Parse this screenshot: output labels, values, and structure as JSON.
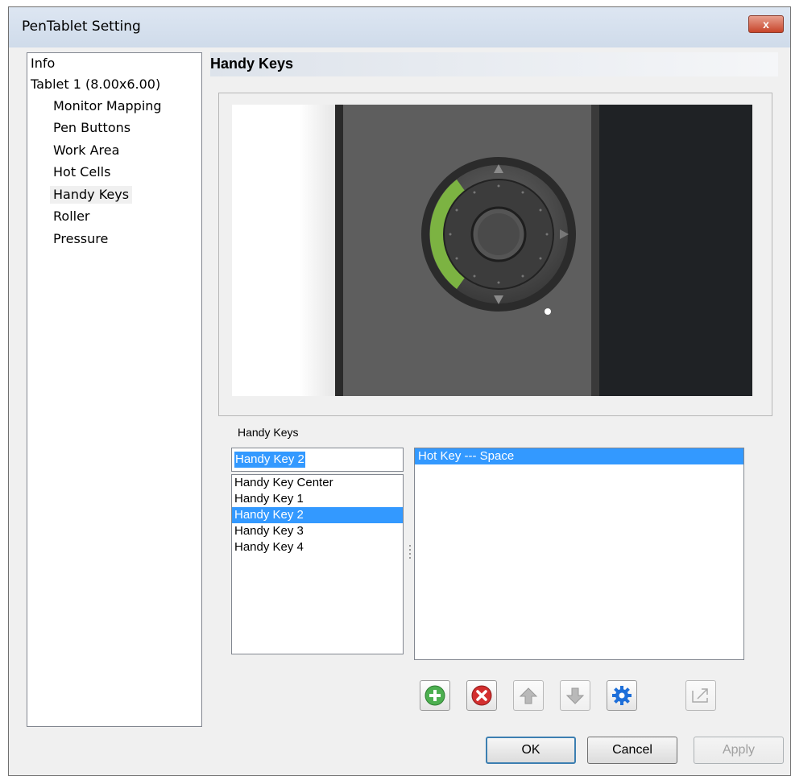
{
  "window": {
    "title": "PenTablet Setting",
    "close_label": "x"
  },
  "tree": [
    {
      "label": "Info",
      "level": 0
    },
    {
      "label": "Tablet 1 (8.00x6.00)",
      "level": 0
    },
    {
      "label": "Monitor Mapping",
      "level": 1
    },
    {
      "label": "Pen Buttons",
      "level": 1
    },
    {
      "label": "Work Area",
      "level": 1
    },
    {
      "label": "Hot Cells",
      "level": 1
    },
    {
      "label": "Handy Keys",
      "level": 1,
      "selected": true
    },
    {
      "label": "Roller",
      "level": 1
    },
    {
      "label": "Pressure",
      "level": 1
    }
  ],
  "panel": {
    "header": "Handy Keys"
  },
  "handy_keys": {
    "group_label": "Handy Keys",
    "current_value": "Handy Key 2",
    "items": [
      "Handy Key Center",
      "Handy Key 1",
      "Handy Key 2",
      "Handy Key 3",
      "Handy Key 4"
    ],
    "selected_item": "Handy Key 2"
  },
  "hotkey_list": {
    "items": [
      "Hot Key --- Space"
    ],
    "selected_item": "Hot Key --- Space"
  },
  "toolbar": {
    "add_icon": "plus-circle-icon",
    "remove_icon": "x-circle-icon",
    "move_up_icon": "arrow-up-icon",
    "move_down_icon": "arrow-down-icon",
    "settings_icon": "gear-icon",
    "import_icon": "import-icon"
  },
  "buttons": {
    "ok": "OK",
    "cancel": "Cancel",
    "apply": "Apply"
  },
  "colors": {
    "selection": "#3399ff",
    "ring_highlight": "#7cb342",
    "close_button": "#c7452a"
  }
}
